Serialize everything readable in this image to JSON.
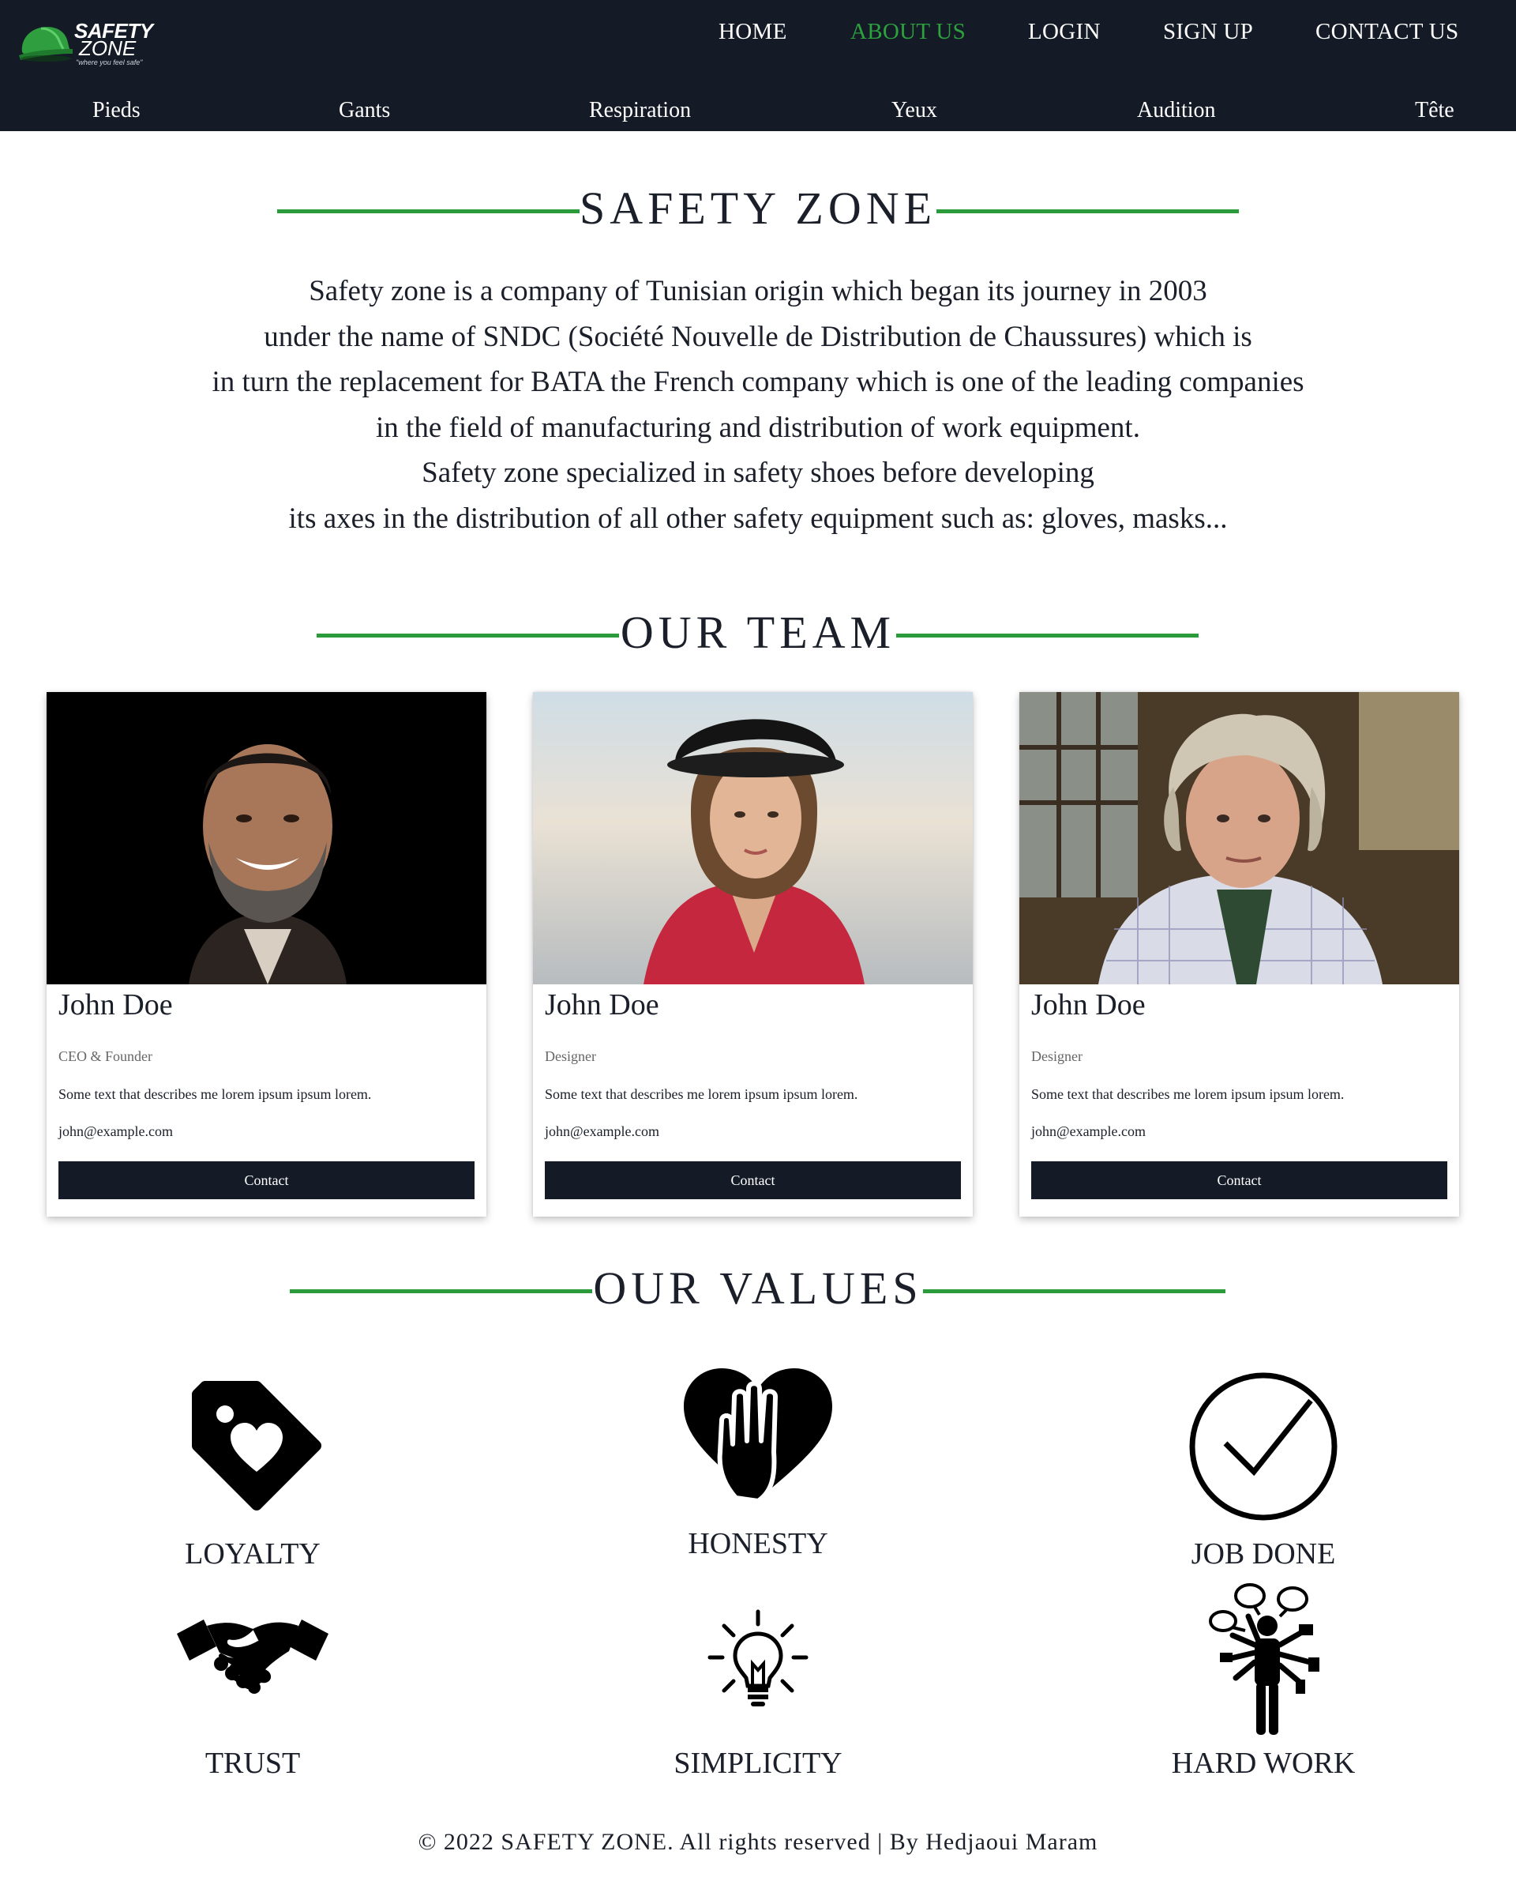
{
  "brand": {
    "logo_line1": "SAFETY",
    "logo_line2": "ZONE",
    "logo_tagline": "\"where you feel safe\""
  },
  "nav": {
    "main": [
      "HOME",
      "ABOUT US",
      "LOGIN",
      "SIGN UP",
      "CONTACT US"
    ],
    "active": "ABOUT US",
    "categories": [
      "Pieds",
      "Gants",
      "Respiration",
      "Yeux",
      "Audition",
      "Tête"
    ]
  },
  "colors": {
    "nav_bg": "#141a26",
    "accent": "#2da13e",
    "text": "#1a1f29"
  },
  "about": {
    "title": "SAFETY ZONE",
    "lines": [
      "Safety zone is a company of Tunisian origin which began its journey in 2003",
      "under the name of SNDC (Société Nouvelle de Distribution de Chaussures) which is",
      "in turn the replacement for BATA the French company which is one of the leading companies",
      "in the field of manufacturing and distribution of work equipment.",
      "Safety zone specialized in safety shoes before developing",
      "its axes in the distribution of all other safety equipment such as: gloves, masks..."
    ]
  },
  "team": {
    "title": "OUR TEAM",
    "members": [
      {
        "name": "John Doe",
        "role": "CEO & Founder",
        "description": "Some text that describes me lorem ipsum ipsum lorem.",
        "email": "john@example.com",
        "button": "Contact"
      },
      {
        "name": "John Doe",
        "role": "Designer",
        "description": "Some text that describes me lorem ipsum ipsum lorem.",
        "email": "john@example.com",
        "button": "Contact"
      },
      {
        "name": "John Doe",
        "role": "Designer",
        "description": "Some text that describes me lorem ipsum ipsum lorem.",
        "email": "john@example.com",
        "button": "Contact"
      }
    ]
  },
  "values": {
    "title": "OUR VALUES",
    "items": [
      {
        "label": "LOYALTY",
        "icon": "price-tag-heart-icon"
      },
      {
        "label": "HONESTY",
        "icon": "heart-hand-icon"
      },
      {
        "label": "JOB DONE",
        "icon": "check-circle-icon"
      },
      {
        "label": "TRUST",
        "icon": "handshake-icon"
      },
      {
        "label": "SIMPLICITY",
        "icon": "lightbulb-icon"
      },
      {
        "label": "HARD WORK",
        "icon": "multitasking-person-icon"
      }
    ]
  },
  "footer": {
    "text": "© 2022 SAFETY ZONE. All rights reserved | By Hedjaoui Maram"
  }
}
